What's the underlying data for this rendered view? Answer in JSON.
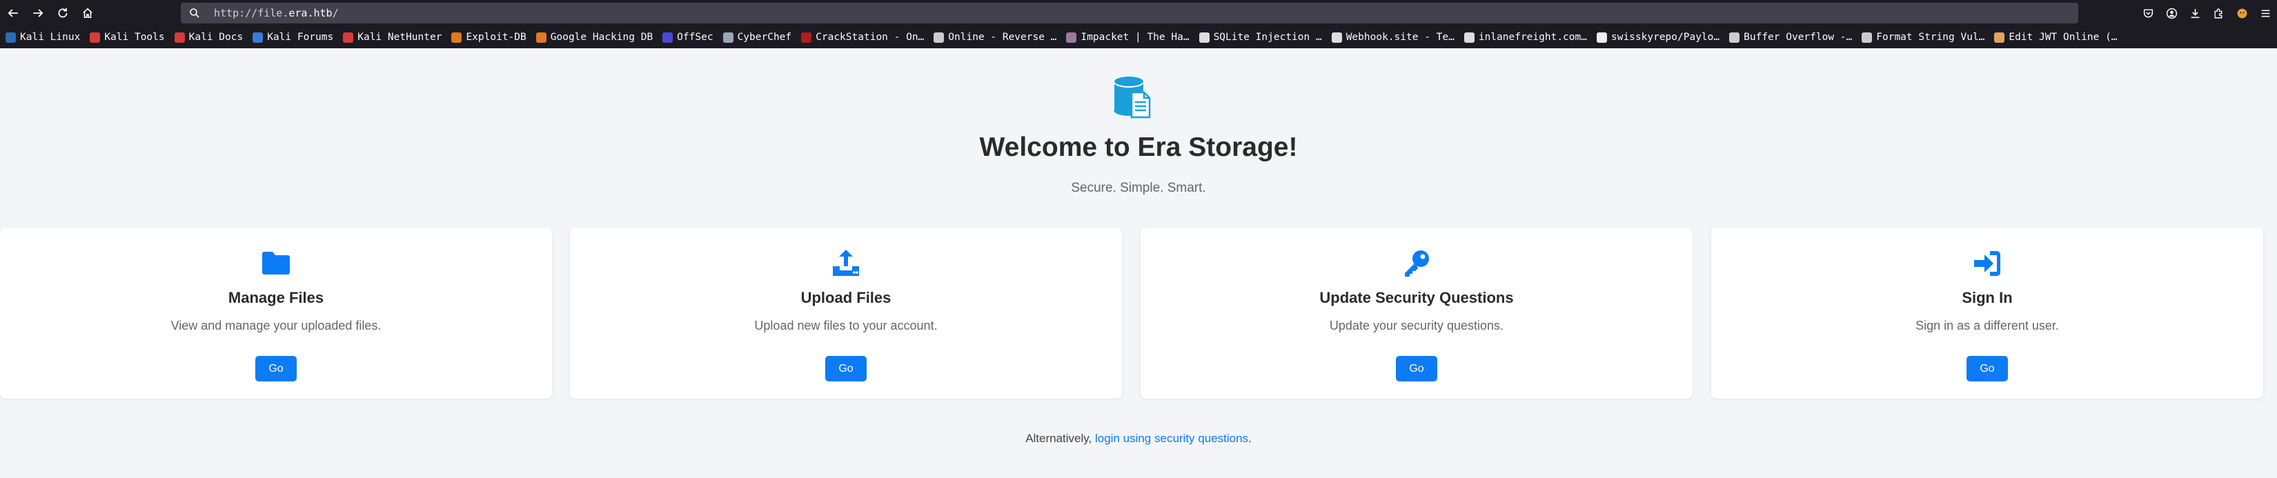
{
  "browser": {
    "url_prefix": "http://file.",
    "url_host": "era.htb",
    "url_suffix": "/",
    "bookmarks": [
      {
        "label": "Kali Linux",
        "color": "#2d6db5"
      },
      {
        "label": "Kali Tools",
        "color": "#d93b3b"
      },
      {
        "label": "Kali Docs",
        "color": "#d93b3b"
      },
      {
        "label": "Kali Forums",
        "color": "#3c7bd9"
      },
      {
        "label": "Kali NetHunter",
        "color": "#d93b3b"
      },
      {
        "label": "Exploit-DB",
        "color": "#e07a1f"
      },
      {
        "label": "Google Hacking DB",
        "color": "#e07a1f"
      },
      {
        "label": "OffSec",
        "color": "#4a4ad9"
      },
      {
        "label": "CyberChef",
        "color": "#9aa6b8"
      },
      {
        "label": "CrackStation - On…",
        "color": "#b01e1e"
      },
      {
        "label": "Online - Reverse …",
        "color": "#cccccc"
      },
      {
        "label": "Impacket | The Ha…",
        "color": "#9a7a9a"
      },
      {
        "label": "SQLite Injection …",
        "color": "#dddddd"
      },
      {
        "label": "Webhook.site - Te…",
        "color": "#dddddd"
      },
      {
        "label": "inlanefreight.com…",
        "color": "#dddddd"
      },
      {
        "label": "swisskyrepo/Paylo…",
        "color": "#eeeeee"
      },
      {
        "label": "Buffer Overflow -…",
        "color": "#cccccc"
      },
      {
        "label": "Format String Vul…",
        "color": "#cccccc"
      },
      {
        "label": "Edit JWT Online (…",
        "color": "#e0a060"
      }
    ]
  },
  "page": {
    "title": "Welcome to Era Storage!",
    "tagline": "Secure. Simple. Smart.",
    "cards": [
      {
        "icon": "folder-icon",
        "title": "Manage Files",
        "desc": "View and manage your uploaded files.",
        "button": "Go"
      },
      {
        "icon": "upload-icon",
        "title": "Upload Files",
        "desc": "Upload new files to your account.",
        "button": "Go"
      },
      {
        "icon": "key-icon",
        "title": "Update Security Questions",
        "desc": "Update your security questions.",
        "button": "Go"
      },
      {
        "icon": "sign-in-icon",
        "title": "Sign In",
        "desc": "Sign in as a different user.",
        "button": "Go"
      }
    ],
    "alt_prefix": "Alternatively,",
    "alt_link": "login using security questions",
    "alt_suffix": "."
  },
  "colors": {
    "accent": "#0b7cf5",
    "background": "#f4f5f8",
    "logo": "#1aa0d8"
  }
}
